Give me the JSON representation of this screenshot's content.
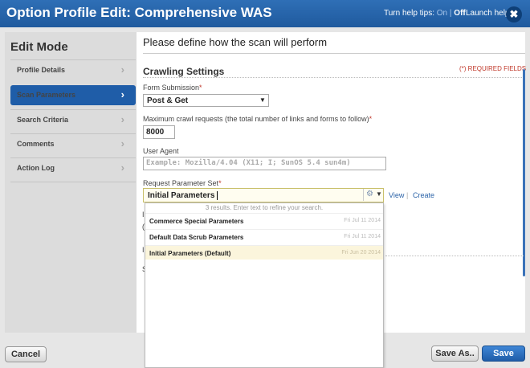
{
  "header": {
    "title": "Option Profile Edit: Comprehensive WAS",
    "help_tips_label": "Turn help tips:",
    "help_on": "On",
    "help_sep": "|",
    "help_off": "Off",
    "launch_help": "Launch help",
    "close_glyph": "✖"
  },
  "sidebar": {
    "title": "Edit Mode",
    "items": [
      {
        "label": "Profile Details",
        "active": false
      },
      {
        "label": "Scan Parameters",
        "active": true
      },
      {
        "label": "Search Criteria",
        "active": false
      },
      {
        "label": "Comments",
        "active": false
      },
      {
        "label": "Action Log",
        "active": false
      }
    ],
    "chevron_glyph": "›"
  },
  "main": {
    "heading": "Please define how the scan will perform",
    "section_title": "Crawling Settings",
    "required_note": "(*) REQUIRED FIELDS",
    "form_submission": {
      "label": "Form Submission",
      "required_mark": "*",
      "value": "Post & Get",
      "arrow_glyph": "▼"
    },
    "max_crawl": {
      "label": "Maximum crawl requests (the total number of links and forms to follow)",
      "required_mark": "*",
      "value": "8000"
    },
    "user_agent": {
      "label": "User Agent",
      "placeholder": "Example: Mozilla/4.04 (X11; I; SunOS 5.4 sun4m)"
    },
    "request_param_set": {
      "label": "Request Parameter Set",
      "required_mark": "*",
      "value": "Initial Parameters",
      "gear_glyph": "⚙",
      "arrow_glyph": "▼",
      "view_link": "View",
      "link_sep": "|",
      "create_link": "Create"
    },
    "dropdown": {
      "hint": "3 results. Enter text to refine your search.",
      "items": [
        {
          "name": "Commerce Special Parameters",
          "date": "Fri Jul 11 2014",
          "selected": false
        },
        {
          "name": "Default Data Scrub Parameters",
          "date": "Fri Jul 11 2014",
          "selected": false
        },
        {
          "name": "Initial Parameters (Default)",
          "date": "Fri Jun 20 2014",
          "selected": true
        }
      ]
    },
    "hidden_bits": {
      "a": "I",
      "b": "(",
      "c": "I",
      "d": "S"
    }
  },
  "footer": {
    "cancel": "Cancel",
    "save_as": "Save As..",
    "save": "Save"
  },
  "colors": {
    "header_blue": "#1f5a9e",
    "active_blue": "#1f5da8",
    "required_red": "#c0392b",
    "link_blue": "#2b63a8"
  }
}
